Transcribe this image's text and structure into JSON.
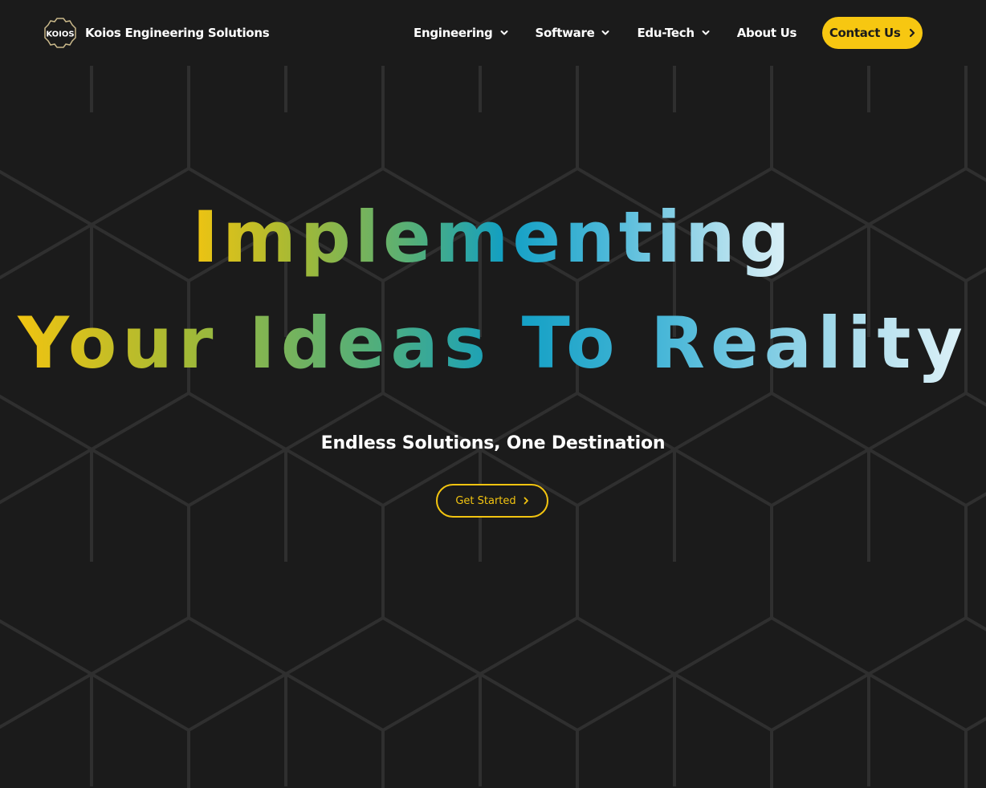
{
  "header": {
    "brand_name": "Koios Engineering Solutions",
    "logo_text": "KOIOS",
    "nav": [
      {
        "label": "Engineering",
        "has_dropdown": true
      },
      {
        "label": "Software",
        "has_dropdown": true
      },
      {
        "label": "Edu-Tech",
        "has_dropdown": true
      },
      {
        "label": "About Us",
        "has_dropdown": false
      }
    ],
    "contact_label": "Contact Us"
  },
  "hero": {
    "line1": "Implementing",
    "line2": "Your Ideas To Reality",
    "tagline": "Endless Solutions, One Destination",
    "cta_label": "Get Started"
  },
  "colors": {
    "background": "#1b1b1b",
    "accent_yellow": "#f7c711",
    "gradient_start": "#f2c410",
    "gradient_mid": "#119fc4",
    "gradient_end": "#dff2f8",
    "hex_lines": "#2e2e2e"
  },
  "icons": {
    "logo": "gear-logo-icon",
    "dropdown": "chevron-down-icon",
    "arrow": "chevron-right-icon"
  }
}
